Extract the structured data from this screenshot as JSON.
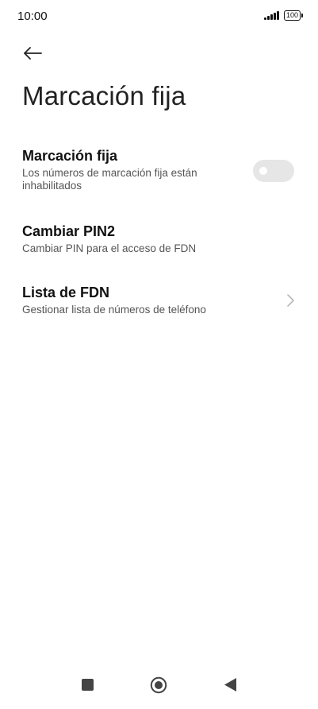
{
  "status_bar": {
    "time": "10:00",
    "battery": "100"
  },
  "header": {
    "back_icon": "arrow-left-icon",
    "title": "Marcación fija"
  },
  "settings": {
    "items": [
      {
        "title": "Marcación fija",
        "description": "Los números de marcación fija están inhabilitados",
        "control": "toggle",
        "toggle_on": false
      },
      {
        "title": "Cambiar PIN2",
        "description": "Cambiar PIN para el acceso de FDN",
        "control": "none"
      },
      {
        "title": "Lista de FDN",
        "description": "Gestionar lista de números de teléfono",
        "control": "chevron-right-icon"
      }
    ]
  },
  "nav_bar": {
    "icons": [
      "square-recents-icon",
      "circle-home-icon",
      "triangle-back-icon"
    ]
  },
  "colors": {
    "background": "#ffffff",
    "title_text": "#111111",
    "description_text": "#555555",
    "toggle_off_track": "#e6e6e6",
    "chevron": "#b0b0b0"
  }
}
